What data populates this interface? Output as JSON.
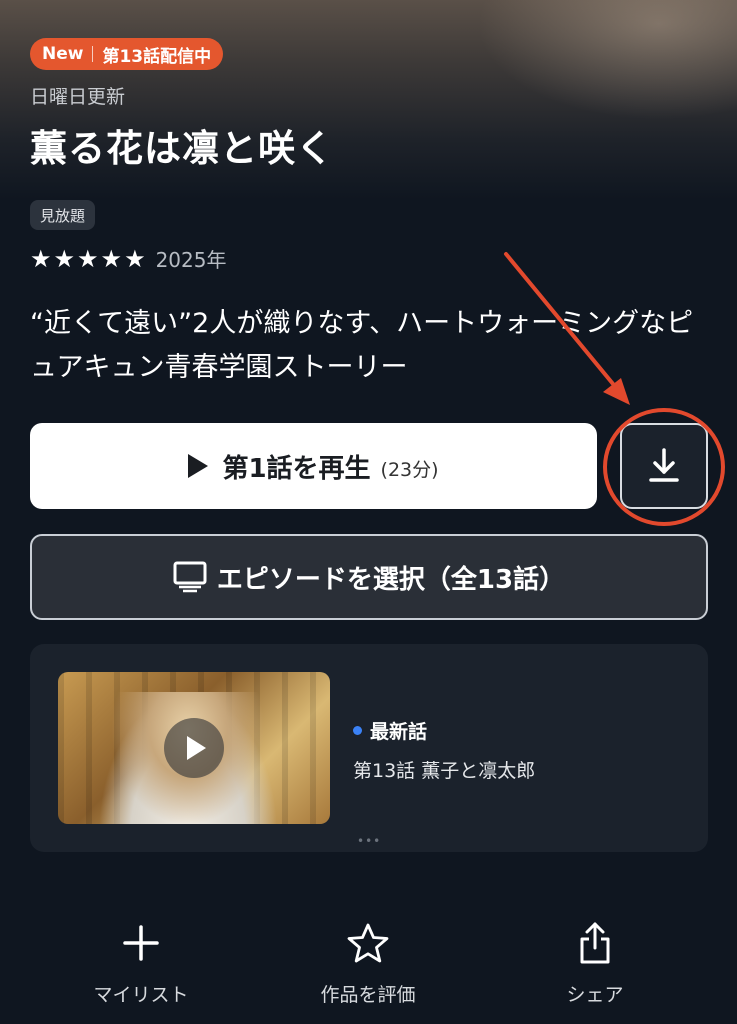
{
  "badge": {
    "new": "New",
    "status": "第13話配信中"
  },
  "update_day": "日曜日更新",
  "title": "薫る花は凛と咲く",
  "tag": "見放題",
  "rating": {
    "stars": "★★★★★",
    "year": "2025年"
  },
  "description": "“近くて遠い”2人が織りなす、ハートウォーミングなピュアキュン青春学園ストーリー",
  "play": {
    "label": "第1話を再生",
    "duration": "(23分)"
  },
  "episodes": {
    "label": "エピソードを選択（全13話）"
  },
  "latest": {
    "label": "最新話",
    "episode": "第13話 薫子と凛太郎",
    "more": "•••"
  },
  "actions": {
    "mylist": "マイリスト",
    "rate": "作品を評価",
    "share": "シェア"
  },
  "colors": {
    "accent_orange": "#e4572e",
    "annotation_red": "#e2492d",
    "latest_dot": "#3b82f6"
  }
}
